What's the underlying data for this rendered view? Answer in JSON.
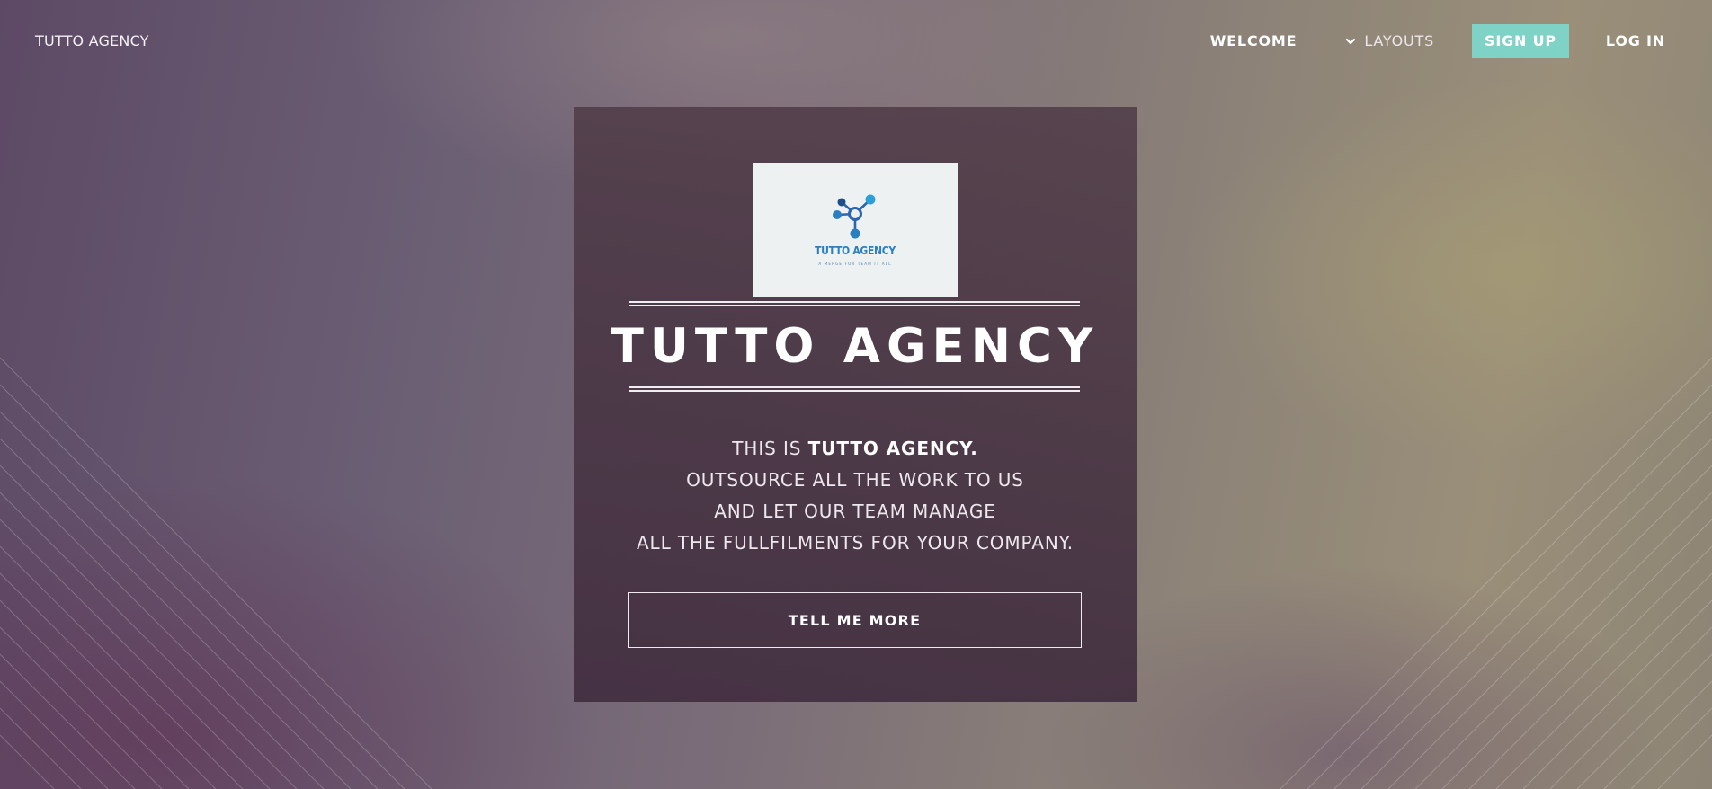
{
  "brand": {
    "name": "TUTTO AGENCY"
  },
  "nav": {
    "welcome": "WELCOME",
    "layouts": "LAYOUTS",
    "signup": "SIGN UP",
    "login": "LOG IN"
  },
  "hero": {
    "logo": {
      "text": "TUTTO AGENCY",
      "tagline": "A MERGE FOR TEAM IT ALL"
    },
    "title": "TUTTO AGENCY",
    "intro_prefix": "THIS IS",
    "intro_bold": "TUTTO AGENCY.",
    "line2": "OUTSOURCE ALL THE WORK TO US",
    "line3": "AND LET OUR TEAM MANAGE",
    "line4": "ALL THE FULLFILMENTS FOR YOUR COMPANY.",
    "cta": "TELL ME MORE"
  },
  "icons": {
    "layouts": "chevron-down-icon",
    "logo": "molecule-network-icon"
  },
  "colors": {
    "signup_bg": "#7fd2c6",
    "logo_blue": "#2a7fc0",
    "logo_dark": "#1f4d8c"
  }
}
